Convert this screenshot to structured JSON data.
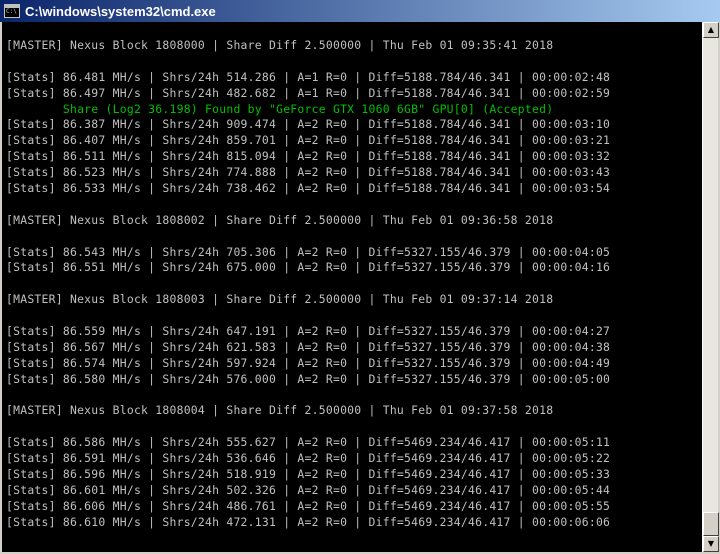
{
  "window": {
    "title": "C:\\windows\\system32\\cmd.exe"
  },
  "icons": {
    "app": "cmd-icon",
    "scroll_up": "arrow-up-icon",
    "scroll_down": "arrow-down-icon"
  },
  "colors": {
    "console_bg": "#000000",
    "console_text": "#c0c0c0",
    "share_text": "#00c000",
    "title_bg": "#0a246a"
  },
  "console": {
    "lines": [
      {
        "type": "master",
        "text": "[MASTER] Nexus Block 1808000 | Share Diff 2.500000 | Thu Feb 01 09:35:41 2018"
      },
      {
        "type": "blank",
        "text": ""
      },
      {
        "type": "stats",
        "text": "[Stats] 86.481 MH/s | Shrs/24h 514.286 | A=1 R=0 | Diff=5188.784/46.341 | 00:00:02:48"
      },
      {
        "type": "stats",
        "text": "[Stats] 86.497 MH/s | Shrs/24h 482.682 | A=1 R=0 | Diff=5188.784/46.341 | 00:00:02:59"
      },
      {
        "type": "share",
        "text": "        Share (Log2 36.198) Found by \"GeForce GTX 1060 6GB\" GPU[0] (Accepted)"
      },
      {
        "type": "stats",
        "text": "[Stats] 86.387 MH/s | Shrs/24h 909.474 | A=2 R=0 | Diff=5188.784/46.341 | 00:00:03:10"
      },
      {
        "type": "stats",
        "text": "[Stats] 86.407 MH/s | Shrs/24h 859.701 | A=2 R=0 | Diff=5188.784/46.341 | 00:00:03:21"
      },
      {
        "type": "stats",
        "text": "[Stats] 86.511 MH/s | Shrs/24h 815.094 | A=2 R=0 | Diff=5188.784/46.341 | 00:00:03:32"
      },
      {
        "type": "stats",
        "text": "[Stats] 86.523 MH/s | Shrs/24h 774.888 | A=2 R=0 | Diff=5188.784/46.341 | 00:00:03:43"
      },
      {
        "type": "stats",
        "text": "[Stats] 86.533 MH/s | Shrs/24h 738.462 | A=2 R=0 | Diff=5188.784/46.341 | 00:00:03:54"
      },
      {
        "type": "blank",
        "text": ""
      },
      {
        "type": "master",
        "text": "[MASTER] Nexus Block 1808002 | Share Diff 2.500000 | Thu Feb 01 09:36:58 2018"
      },
      {
        "type": "blank",
        "text": ""
      },
      {
        "type": "stats",
        "text": "[Stats] 86.543 MH/s | Shrs/24h 705.306 | A=2 R=0 | Diff=5327.155/46.379 | 00:00:04:05"
      },
      {
        "type": "stats",
        "text": "[Stats] 86.551 MH/s | Shrs/24h 675.000 | A=2 R=0 | Diff=5327.155/46.379 | 00:00:04:16"
      },
      {
        "type": "blank",
        "text": ""
      },
      {
        "type": "master",
        "text": "[MASTER] Nexus Block 1808003 | Share Diff 2.500000 | Thu Feb 01 09:37:14 2018"
      },
      {
        "type": "blank",
        "text": ""
      },
      {
        "type": "stats",
        "text": "[Stats] 86.559 MH/s | Shrs/24h 647.191 | A=2 R=0 | Diff=5327.155/46.379 | 00:00:04:27"
      },
      {
        "type": "stats",
        "text": "[Stats] 86.567 MH/s | Shrs/24h 621.583 | A=2 R=0 | Diff=5327.155/46.379 | 00:00:04:38"
      },
      {
        "type": "stats",
        "text": "[Stats] 86.574 MH/s | Shrs/24h 597.924 | A=2 R=0 | Diff=5327.155/46.379 | 00:00:04:49"
      },
      {
        "type": "stats",
        "text": "[Stats] 86.580 MH/s | Shrs/24h 576.000 | A=2 R=0 | Diff=5327.155/46.379 | 00:00:05:00"
      },
      {
        "type": "blank",
        "text": ""
      },
      {
        "type": "master",
        "text": "[MASTER] Nexus Block 1808004 | Share Diff 2.500000 | Thu Feb 01 09:37:58 2018"
      },
      {
        "type": "blank",
        "text": ""
      },
      {
        "type": "stats",
        "text": "[Stats] 86.586 MH/s | Shrs/24h 555.627 | A=2 R=0 | Diff=5469.234/46.417 | 00:00:05:11"
      },
      {
        "type": "stats",
        "text": "[Stats] 86.591 MH/s | Shrs/24h 536.646 | A=2 R=0 | Diff=5469.234/46.417 | 00:00:05:22"
      },
      {
        "type": "stats",
        "text": "[Stats] 86.596 MH/s | Shrs/24h 518.919 | A=2 R=0 | Diff=5469.234/46.417 | 00:00:05:33"
      },
      {
        "type": "stats",
        "text": "[Stats] 86.601 MH/s | Shrs/24h 502.326 | A=2 R=0 | Diff=5469.234/46.417 | 00:00:05:44"
      },
      {
        "type": "stats",
        "text": "[Stats] 86.606 MH/s | Shrs/24h 486.761 | A=2 R=0 | Diff=5469.234/46.417 | 00:00:05:55"
      },
      {
        "type": "stats",
        "text": "[Stats] 86.610 MH/s | Shrs/24h 472.131 | A=2 R=0 | Diff=5469.234/46.417 | 00:00:06:06"
      }
    ]
  }
}
